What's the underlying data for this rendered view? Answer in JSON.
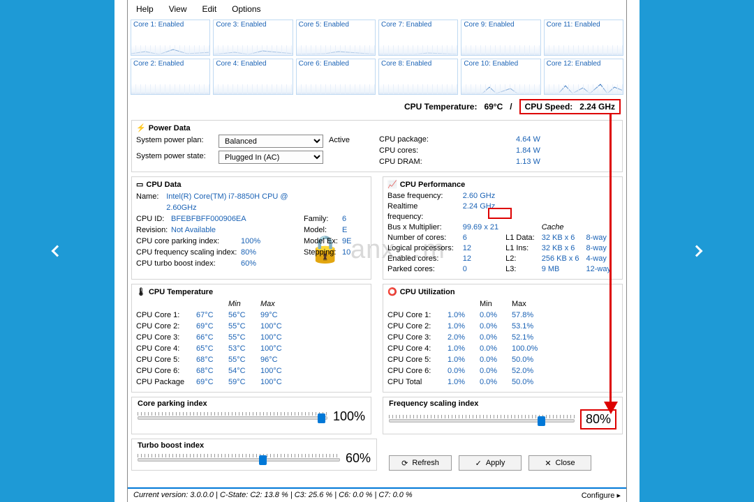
{
  "menu": [
    "Help",
    "View",
    "Edit",
    "Options"
  ],
  "cores_row1": [
    "Core 1: Enabled",
    "Core 3: Enabled",
    "Core 5: Enabled",
    "Core 7: Enabled",
    "Core 9: Enabled",
    "Core 11: Enabled"
  ],
  "cores_row2": [
    "Core 2: Enabled",
    "Core 4: Enabled",
    "Core 6: Enabled",
    "Core 8: Enabled",
    "Core 10: Enabled",
    "Core 12: Enabled"
  ],
  "summary": {
    "temp_lbl": "CPU Temperature:",
    "temp": "69°C",
    "sep": "/",
    "speed_lbl": "CPU Speed:",
    "speed": "2.24 GHz"
  },
  "power": {
    "title": "Power Data",
    "plan_lbl": "System power plan:",
    "plan": "Balanced",
    "active": "Active",
    "state_lbl": "System power state:",
    "state": "Plugged In (AC)",
    "pkg_lbl": "CPU package:",
    "pkg": "4.64 W",
    "cores_lbl": "CPU cores:",
    "cores": "1.84 W",
    "dram_lbl": "CPU DRAM:",
    "dram": "1.13 W"
  },
  "cpu": {
    "title": "CPU Data",
    "name_lbl": "Name:",
    "name": "Intel(R) Core(TM) i7-8850H CPU @ 2.60GHz",
    "id_lbl": "CPU ID:",
    "id": "BFEBFBFF000906EA",
    "rev_lbl": "Revision:",
    "rev": "Not Available",
    "park_lbl": "CPU core parking index:",
    "park": "100%",
    "scal_lbl": "CPU frequency scaling index:",
    "scal": "80%",
    "turbo_lbl": "CPU turbo boost index:",
    "turbo": "60%",
    "fam_lbl": "Family:",
    "fam": "6",
    "mdl_lbl": "Model:",
    "mdl": "E",
    "mex_lbl": "Model Ex:",
    "mex": "9E",
    "stp_lbl": "Stepping:",
    "stp": "10"
  },
  "perf": {
    "title": "CPU Performance",
    "base_lbl": "Base frequency:",
    "base": "2.60 GHz",
    "real_lbl": "Realtime frequency:",
    "real": "2.24 GHz",
    "bus_lbl": "Bus x Multiplier:",
    "bus": "99.69 x 21",
    "nc_lbl": "Number of cores:",
    "nc": "6",
    "lp_lbl": "Logical processors:",
    "lp": "12",
    "ec_lbl": "Enabled cores:",
    "ec": "12",
    "pc_lbl": "Parked cores:",
    "pc": "0",
    "cache": "Cache",
    "l1d_lbl": "L1 Data:",
    "l1d": "32 KB x 6",
    "l1d_w": "8-way",
    "l1i_lbl": "L1 Ins:",
    "l1i": "32 KB x 6",
    "l1i_w": "8-way",
    "l2_lbl": "L2:",
    "l2": "256 KB x 6",
    "l2_w": "4-way",
    "l3_lbl": "L3:",
    "l3": "9 MB",
    "l3_w": "12-way"
  },
  "temp": {
    "title": "CPU Temperature",
    "min": "Min",
    "max": "Max",
    "rows": [
      {
        "n": "CPU Core 1:",
        "c": "67°C",
        "mn": "56°C",
        "mx": "99°C"
      },
      {
        "n": "CPU Core 2:",
        "c": "69°C",
        "mn": "55°C",
        "mx": "100°C"
      },
      {
        "n": "CPU Core 3:",
        "c": "66°C",
        "mn": "55°C",
        "mx": "100°C"
      },
      {
        "n": "CPU Core 4:",
        "c": "65°C",
        "mn": "53°C",
        "mx": "100°C"
      },
      {
        "n": "CPU Core 5:",
        "c": "68°C",
        "mn": "55°C",
        "mx": "96°C"
      },
      {
        "n": "CPU Core 6:",
        "c": "68°C",
        "mn": "54°C",
        "mx": "100°C"
      },
      {
        "n": "CPU Package",
        "c": "69°C",
        "mn": "59°C",
        "mx": "100°C"
      }
    ]
  },
  "util": {
    "title": "CPU Utilization",
    "min": "Min",
    "max": "Max",
    "rows": [
      {
        "n": "CPU Core 1:",
        "c": "1.0%",
        "mn": "0.0%",
        "mx": "57.8%"
      },
      {
        "n": "CPU Core 2:",
        "c": "1.0%",
        "mn": "0.0%",
        "mx": "53.1%"
      },
      {
        "n": "CPU Core 3:",
        "c": "2.0%",
        "mn": "0.0%",
        "mx": "52.1%"
      },
      {
        "n": "CPU Core 4:",
        "c": "1.0%",
        "mn": "0.0%",
        "mx": "100.0%"
      },
      {
        "n": "CPU Core 5:",
        "c": "1.0%",
        "mn": "0.0%",
        "mx": "50.0%"
      },
      {
        "n": "CPU Core 6:",
        "c": "0.0%",
        "mn": "0.0%",
        "mx": "52.0%"
      },
      {
        "n": "CPU Total",
        "c": "1.0%",
        "mn": "0.0%",
        "mx": "50.0%"
      }
    ]
  },
  "sliders": {
    "park": {
      "lbl": "Core parking index",
      "val": "100%",
      "pos": 99
    },
    "freq": {
      "lbl": "Frequency scaling index",
      "val": "80%",
      "pos": 80
    },
    "turbo": {
      "lbl": "Turbo boost index",
      "val": "60%",
      "pos": 60
    }
  },
  "buttons": {
    "refresh": "Refresh",
    "apply": "Apply",
    "close": "Close"
  },
  "status": {
    "ver": "Current version:  3.0.0.0",
    "cstate": "C-State:   C2:   13.8 %   |   C3:   25.6 %   |   C6:   0.0 %   |   C7:   0.0 %",
    "cfg": "Configure ▸"
  }
}
